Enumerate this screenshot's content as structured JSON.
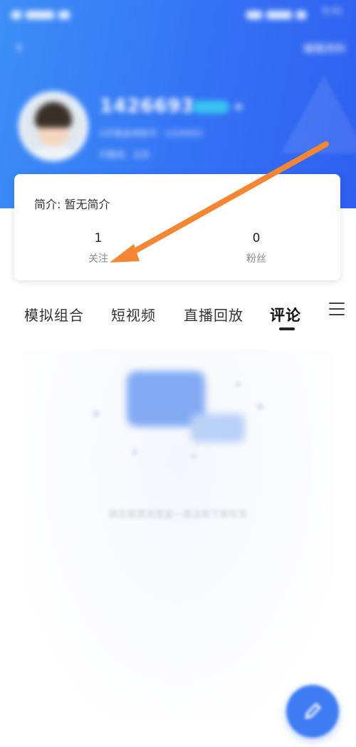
{
  "header": {
    "status_time": "9:41",
    "back_glyph": "‹",
    "edit_label": "编辑资料",
    "user": {
      "name": "1426693",
      "line1": "A手股金用账号 · 1426693",
      "line2": "IP属地：北京"
    }
  },
  "profile_card": {
    "intro_label": "简介: 暂无简介",
    "follow_count": "1",
    "follow_label": "关注",
    "fans_count": "0",
    "fans_label": "粉丝"
  },
  "tabs": {
    "items": [
      "模拟组合",
      "短视频",
      "直播回放",
      "评论"
    ],
    "active_index": 3,
    "menu_icon": "menu-icon"
  },
  "empty_state": {
    "text": "我在股票池里面一直没有下单任务"
  },
  "fab": {
    "icon": "edit-pencil-icon"
  },
  "colors": {
    "header_blue": "#3575f5",
    "arrow_orange": "#f58634",
    "fab_blue": "#3e7cf3"
  }
}
